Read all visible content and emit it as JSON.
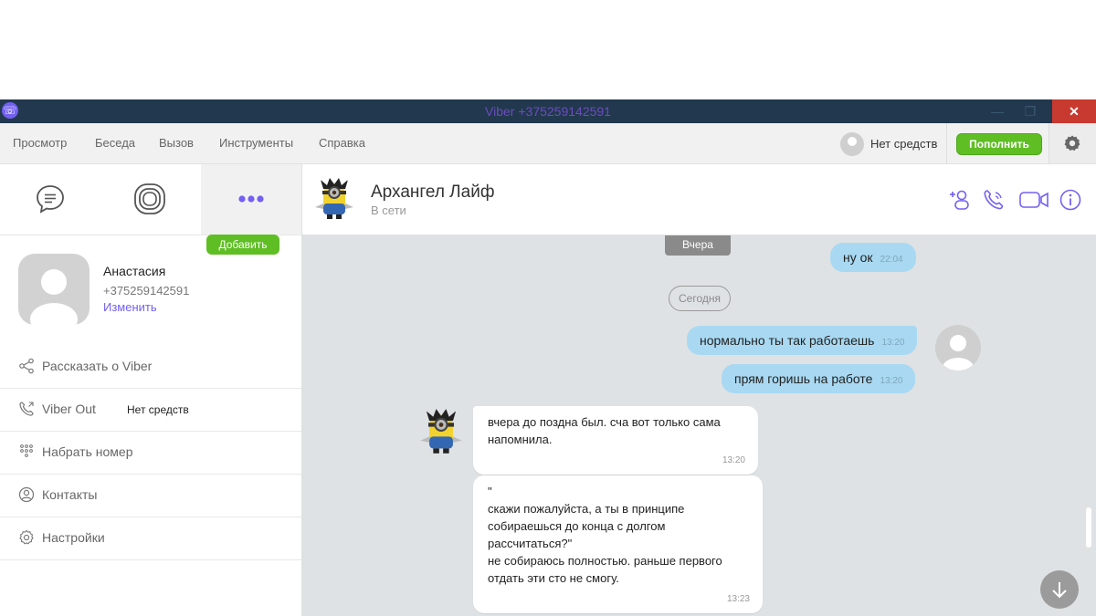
{
  "window": {
    "title": "Viber +375259142591",
    "minimize_label": "—",
    "maximize_label": "❐",
    "close_label": "✕"
  },
  "menu": {
    "items": [
      "Просмотр",
      "Беседа",
      "Вызов",
      "Инструменты",
      "Справка"
    ],
    "balance_text": "Нет средств",
    "topup_label": "Пополнить"
  },
  "left_panel": {
    "tabs": [
      "chat-icon",
      "stories-icon",
      "more-icon"
    ],
    "profile": {
      "name": "Анастасия",
      "phone": "+375259142591",
      "edit_label": "Изменить"
    },
    "items": [
      {
        "label": "Рассказать о Viber",
        "icon": "share-icon"
      },
      {
        "label": "Viber Out",
        "icon": "viber-out-icon",
        "balance": "Нет средств",
        "action": "Добавить"
      },
      {
        "label": "Набрать номер",
        "icon": "dialpad-icon"
      },
      {
        "label": "Контакты",
        "icon": "contacts-icon"
      },
      {
        "label": "Настройки",
        "icon": "settings-icon"
      }
    ]
  },
  "chat_header": {
    "contact_name": "Архангел Лайф",
    "status": "В сети",
    "actions": [
      "add-participant-icon",
      "call-icon",
      "video-call-icon",
      "info-icon"
    ]
  },
  "chat": {
    "dividers": {
      "yesterday": "Вчера",
      "today": "Сегодня"
    },
    "messages": [
      {
        "dir": "out",
        "text": "ну ок",
        "time": "22:04"
      },
      {
        "dir": "out",
        "text": "нормально ты так работаешь",
        "time": "13:20"
      },
      {
        "dir": "out",
        "text": "прям горишь на работе",
        "time": "13:20"
      },
      {
        "dir": "in",
        "lines": [
          "вчера до поздна был. сча вот только сама",
          "напомнила."
        ],
        "time": "13:20"
      },
      {
        "dir": "in",
        "lines": [
          "\"",
          "скажи пожалуйста, а ты в принципе",
          "собираешься до конца с долгом",
          "рассчитаться?\"",
          "не собираюсь полностью. раньше первого",
          "отдать эти сто не смогу."
        ],
        "time": "13:23"
      }
    ]
  },
  "colors": {
    "titlebar": "#22384e",
    "accent": "#7360f2",
    "green": "#5fbe24",
    "outgoing_bubble": "#a9d9f2",
    "chat_bg": "#dfe2e4"
  }
}
